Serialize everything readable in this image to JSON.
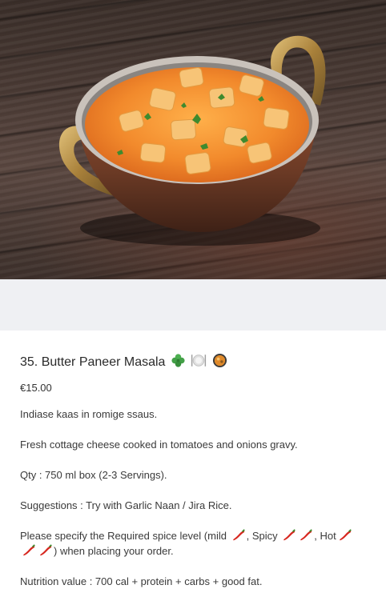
{
  "product": {
    "title": "35. Butter Paneer Masala",
    "title_icons": [
      "shamrock-icon",
      "plate-cutlery-icon",
      "curry-bowl-icon"
    ],
    "price": "€15.00",
    "description_nl": "Indiase kaas in romige ssaus.",
    "description_en": "Fresh cottage cheese cooked in tomatoes and onions gravy.",
    "qty": "Qty : 750 ml box (2-3 Servings).",
    "suggestions": "Suggestions : Try with Garlic Naan / Jira Rice.",
    "spice": {
      "prefix": "Please specify the Required spice level (mild",
      "spicy": ", Spicy",
      "hot": ", Hot",
      "suffix": ") when placing your order."
    },
    "nutrition": "Nutrition value : 700 cal + protein + carbs + good fat."
  },
  "colors": {
    "band": "#eff0f3",
    "chili_red": "#d7261e",
    "curry_orange": "#f08a2c"
  }
}
